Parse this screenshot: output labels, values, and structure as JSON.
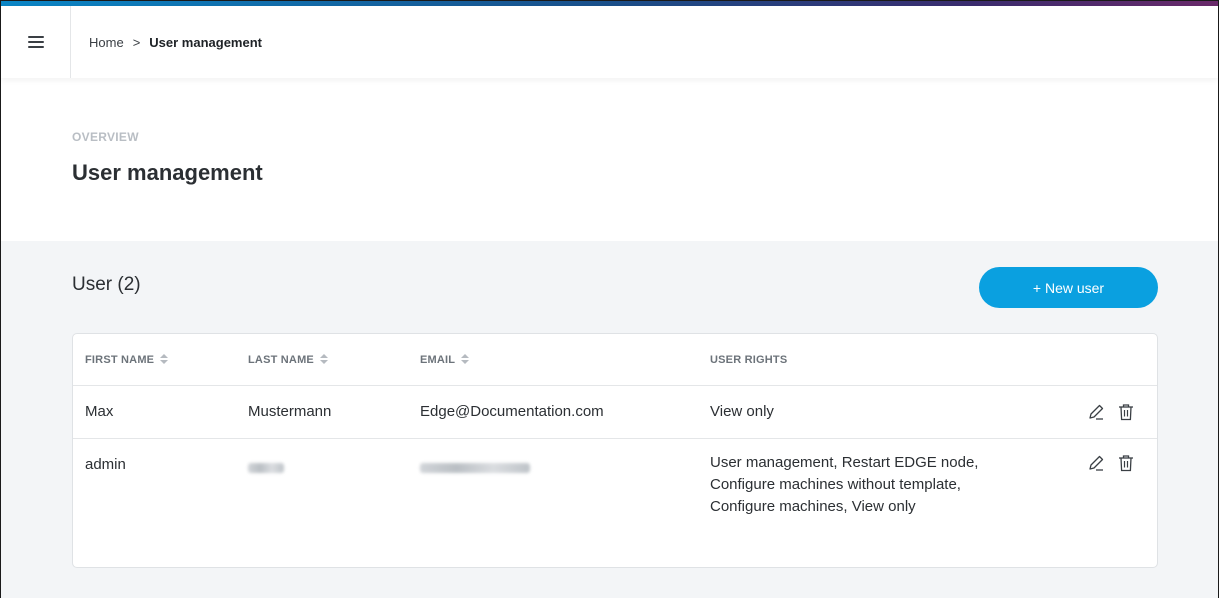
{
  "breadcrumb": {
    "home": "Home",
    "separator": ">",
    "current": "User management"
  },
  "header": {
    "eyebrow": "OVERVIEW",
    "title": "User management"
  },
  "section": {
    "title": "User (2)",
    "new_user_label": "+ New user"
  },
  "table": {
    "columns": [
      "FIRST NAME",
      "LAST NAME",
      "EMAIL",
      "USER RIGHTS"
    ],
    "rows": [
      {
        "first_name": "Max",
        "last_name": "Mustermann",
        "email": "Edge@Documentation.com",
        "rights": "View only"
      },
      {
        "first_name": "admin",
        "last_name": "",
        "email": "",
        "rights": "User management, Restart EDGE node, Configure machines without template, Configure machines, View only"
      }
    ]
  },
  "icons": {
    "menu": "hamburger-icon",
    "sort": "sort-icon",
    "edit": "pencil-icon",
    "delete": "trash-icon"
  },
  "colors": {
    "accent": "#0aa0e0",
    "content_bg": "#f3f5f7",
    "muted_text": "#b9bec4"
  }
}
